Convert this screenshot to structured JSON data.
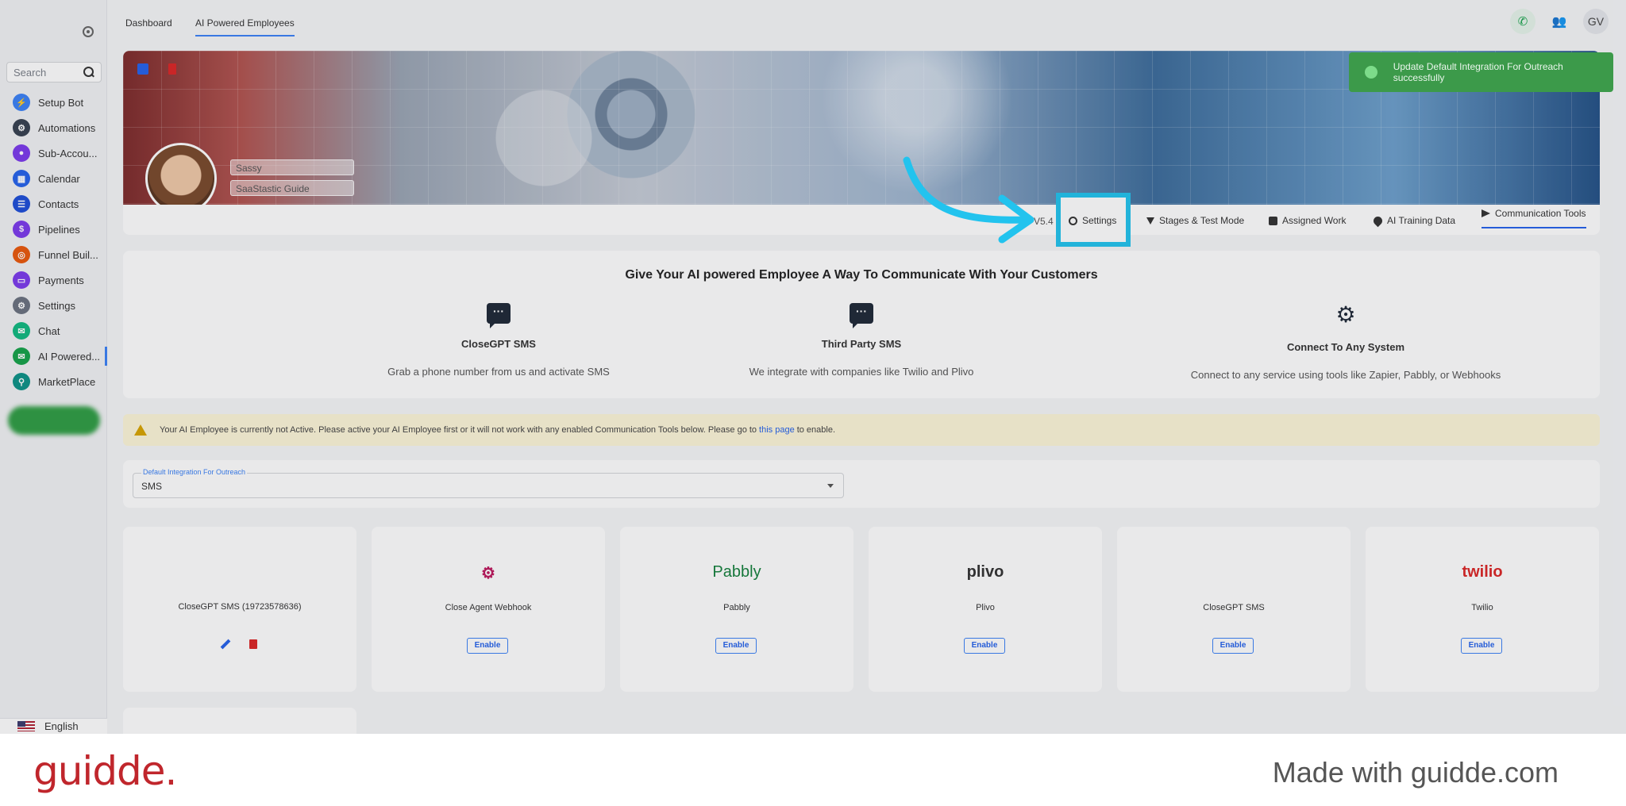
{
  "sidebar": {
    "search_placeholder": "Search",
    "items": [
      {
        "label": "Setup Bot",
        "color": "#3b82f6",
        "glyph": "⚡"
      },
      {
        "label": "Automations",
        "color": "#374151",
        "glyph": "⚙"
      },
      {
        "label": "Sub-Accou...",
        "color": "#7c3aed",
        "glyph": "●"
      },
      {
        "label": "Calendar",
        "color": "#2563eb",
        "glyph": "▦"
      },
      {
        "label": "Contacts",
        "color": "#1d4ed8",
        "glyph": "☰"
      },
      {
        "label": "Pipelines",
        "color": "#7c3aed",
        "glyph": "$"
      },
      {
        "label": "Funnel Buil...",
        "color": "#ea580c",
        "glyph": "◎"
      },
      {
        "label": "Payments",
        "color": "#7c3aed",
        "glyph": "▭"
      },
      {
        "label": "Settings",
        "color": "#6b7280",
        "glyph": "⚙"
      },
      {
        "label": "Chat",
        "color": "#10b981",
        "glyph": "✉"
      },
      {
        "label": "AI Powered...",
        "color": "#16a34a",
        "glyph": "✉"
      },
      {
        "label": "MarketPlace",
        "color": "#0d9488",
        "glyph": "⚲"
      }
    ],
    "language": "English"
  },
  "topbar": {
    "tabs": [
      "Dashboard",
      "AI Powered Employees"
    ],
    "avatar_initials": "GV"
  },
  "profile": {
    "name": "Sassy",
    "subtitle": "SaaStastic Guide"
  },
  "tabs": {
    "version": "V5.4",
    "items": [
      "Settings",
      "Stages & Test Mode",
      "Assigned Work",
      "AI Training Data",
      "Communication Tools"
    ]
  },
  "communication": {
    "title": "Give Your AI powered Employee A Way To Communicate With Your Customers",
    "options": [
      {
        "title": "CloseGPT SMS",
        "desc": "Grab a phone number from us and activate SMS"
      },
      {
        "title": "Third Party SMS",
        "desc": "We integrate with companies like Twilio and Plivo"
      },
      {
        "title": "Connect To Any System",
        "desc": "Connect to any service using tools like Zapier, Pabbly, or Webhooks"
      }
    ]
  },
  "warning": {
    "text_before": "Your AI Employee is currently not Active. Please active your AI Employee first or it will not work with any enabled Communication Tools below. Please go to",
    "link": "this page",
    "text_after": "to enable."
  },
  "outreach": {
    "label": "Default Integration For Outreach",
    "value": "SMS"
  },
  "integrations": [
    {
      "name": "CloseGPT SMS (19723578636)",
      "logo": ""
    },
    {
      "name": "Close Agent Webhook",
      "logo": "",
      "enable": "Enable"
    },
    {
      "name": "Pabbly",
      "logo": "Pabbly",
      "enable": "Enable"
    },
    {
      "name": "Plivo",
      "logo": "plivo",
      "enable": "Enable"
    },
    {
      "name": "CloseGPT SMS",
      "logo": "",
      "enable": "Enable"
    },
    {
      "name": "Twilio",
      "logo": "twilio",
      "enable": "Enable"
    }
  ],
  "toast": {
    "message": "Update Default Integration For Outreach successfully"
  },
  "footer": {
    "brand": "guidde.",
    "tagline": "Made with guidde.com"
  }
}
